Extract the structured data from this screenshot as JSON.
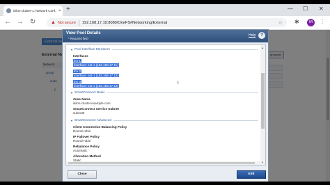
{
  "browser": {
    "tab_title": "isilon-cluster-1: Network Conf...",
    "tab_close": "×",
    "new_tab": "+",
    "win_min": "—",
    "win_max": "☐",
    "win_close": "✕",
    "security_label": "Not secure",
    "url": "192.168.17.10:8080/OneFS#Networking/External",
    "avatar_letter": "M"
  },
  "background": {
    "left_tab": "External Ne",
    "section_title": "External Ne",
    "network_label": "Network",
    "tree_items": [
      "group",
      "subn",
      "p"
    ],
    "right_button": "groupnet"
  },
  "dialog": {
    "title": "View Pool Details",
    "required_note": "* Required field",
    "help_label": "Help",
    "help_icon": "?",
    "sections": {
      "pool_interface": "Pool Interface Members",
      "smartconnect_basic": "SmartConnect Basic",
      "smartconnect_advanced": "SmartConnect Advanced"
    },
    "interfaces_label": "Interfaces",
    "interfaces": [
      {
        "node": "lnn 1",
        "iface": "interface: ext-1 (192.168.17.11)"
      },
      {
        "node": "lnn 2",
        "iface": "interface: ext-1 (192.168.17.12)"
      },
      {
        "node": "lnn 3",
        "iface": "interface: ext-1 (192.168.17.13)"
      }
    ],
    "zone_name_label": "Zone Name",
    "zone_name_value": "isilon.cluster.example.com",
    "service_subnet_label": "SmartConnect Service Subnet",
    "service_subnet_value": "subnet0",
    "client_policy_label": "Client Connection Balancing Policy",
    "client_policy_value": "Round-robin",
    "ip_failover_label": "IP Failover Policy",
    "ip_failover_value": "Round-robin",
    "rebalance_label": "Rebalance Policy",
    "rebalance_value": "Automatic",
    "allocation_label": "Allocation Method",
    "allocation_value": "Static",
    "close_label": "Close",
    "edit_label": "Edit"
  },
  "colors": {
    "dialog_header": "#2e4f7a",
    "selection": "#3b70d8",
    "edit_button": "#1e4a8c"
  }
}
